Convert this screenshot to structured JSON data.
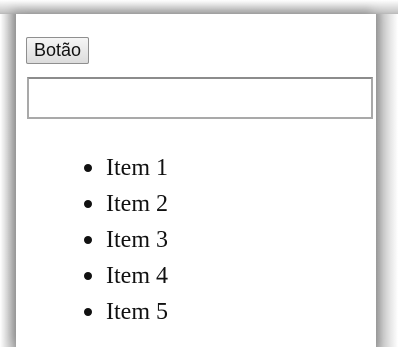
{
  "toolbar": {
    "button_label": "Botão"
  },
  "form": {
    "input_value": "",
    "input_placeholder": ""
  },
  "list": {
    "items": [
      "Item 1",
      "Item 2",
      "Item 3",
      "Item 4",
      "Item 5"
    ]
  },
  "colors": {
    "background": "#ffffff",
    "frame": "#bdbdbd",
    "text": "#111111"
  }
}
